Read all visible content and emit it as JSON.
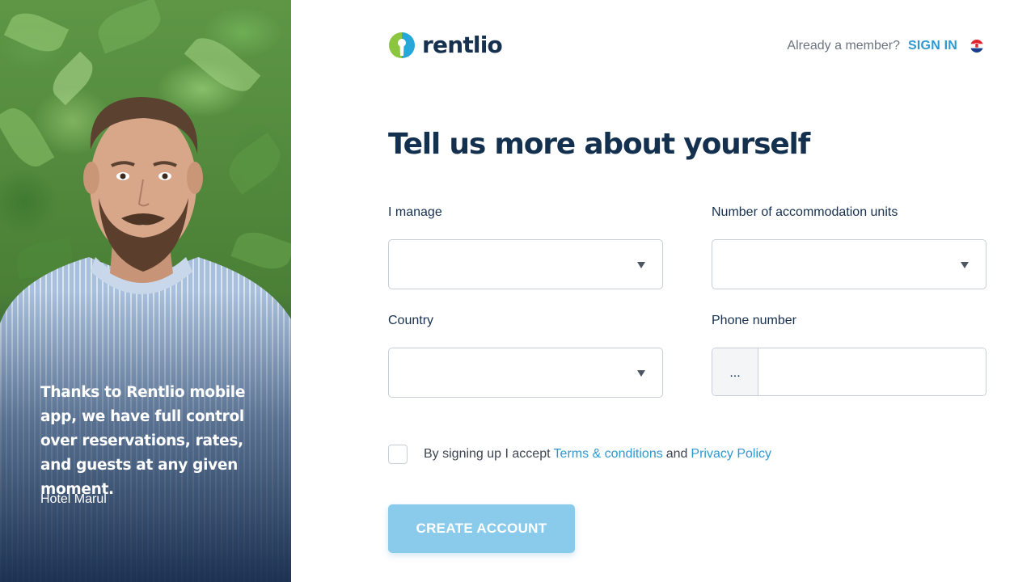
{
  "hero": {
    "quote": "Thanks to Rentlio mobile app, we have full control over reservations, rates, and guests at any given moment.",
    "author": "Hotel Marul"
  },
  "header": {
    "logo_text": "rentlio",
    "member_text": "Already a member?",
    "signin_label": "SIGN IN",
    "language_flag_icon": "croatia-flag-icon"
  },
  "form": {
    "title": "Tell us more about yourself",
    "manage_label": "I manage",
    "manage_value": "",
    "units_label": "Number of accommodation units",
    "units_value": "",
    "country_label": "Country",
    "country_value": "",
    "phone_label": "Phone number",
    "phone_prefix": "...",
    "phone_value": "",
    "terms_prefix": "By signing up I accept",
    "terms_link": "Terms & conditions",
    "terms_and": "and",
    "privacy_link": "Privacy Policy",
    "submit_label": "CREATE ACCOUNT"
  },
  "colors": {
    "brand_navy": "#16304f",
    "accent_blue": "#2f98cf",
    "button_disabled": "#8acbec",
    "logo_green": "#8cc63f"
  }
}
